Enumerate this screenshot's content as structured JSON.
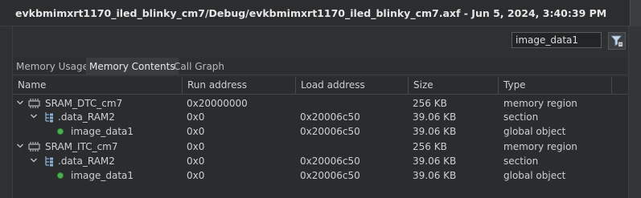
{
  "window": {
    "title": "evkbmimxrt1170_iled_blinky_cm7/Debug/evkbmimxrt1170_iled_blinky_cm7.axf - Jun 5, 2024, 3:40:39 PM"
  },
  "toolbar": {
    "filter_value": "image_data1",
    "filter_icon": "filter-icon"
  },
  "tabs": [
    {
      "label": "Memory Usage",
      "active": false
    },
    {
      "label": "Memory Contents",
      "active": true
    },
    {
      "label": "Call Graph",
      "active": false
    }
  ],
  "table": {
    "columns": [
      "Name",
      "Run address",
      "Load address",
      "Size",
      "Type"
    ],
    "rows": [
      {
        "name": "SRAM_DTC_cm7",
        "run": "0x20000000",
        "load": "",
        "size": "256 KB",
        "type": "memory region",
        "icon": "memory-region-icon",
        "expanded": true
      },
      {
        "name": ".data_RAM2",
        "run": "0x0",
        "load": "0x20006c50",
        "size": "39.06 KB",
        "type": "section",
        "icon": "section-icon",
        "expanded": true
      },
      {
        "name": "image_data1",
        "run": "0x0",
        "load": "0x20006c50",
        "size": "39.06 KB",
        "type": "global object",
        "icon": "global-object-icon"
      },
      {
        "name": "SRAM_ITC_cm7",
        "run": "0x0",
        "load": "",
        "size": "256 KB",
        "type": "memory region",
        "icon": "memory-region-icon",
        "expanded": true
      },
      {
        "name": ".data_RAM2",
        "run": "0x0",
        "load": "0x20006c50",
        "size": "39.06 KB",
        "type": "section",
        "icon": "section-icon",
        "expanded": true
      },
      {
        "name": "image_data1",
        "run": "0x0",
        "load": "0x20006c50",
        "size": "39.06 KB",
        "type": "global object",
        "icon": "global-object-icon"
      }
    ]
  },
  "colors": {
    "background": "#2f3133",
    "active_tab": "#3a3d40",
    "global_object_icon": "#4caf50",
    "region_icon": "#c8c8c8",
    "section_icon": "#8fb0d8"
  }
}
